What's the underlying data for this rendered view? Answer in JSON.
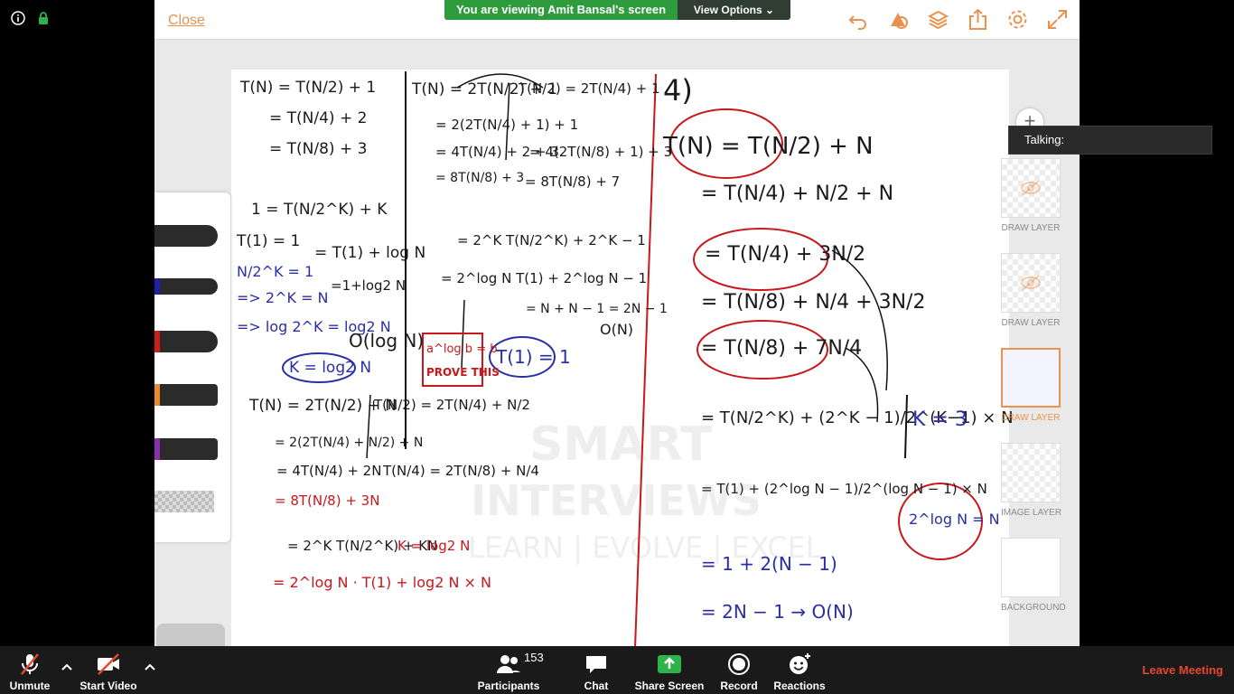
{
  "banner": {
    "message": "You are viewing Amit Bansal's screen",
    "view_options": "View Options"
  },
  "app": {
    "close_label": "Close",
    "tools": [
      "undo-icon",
      "shapes-icon",
      "layers-icon",
      "export-icon",
      "settings-icon",
      "fullscreen-icon"
    ],
    "layers": [
      {
        "label": "DRAW LAYER",
        "hidden": true
      },
      {
        "label": "DRAW LAYER",
        "hidden": true
      },
      {
        "label": "DRAW LAYER",
        "hidden": false,
        "active": true
      },
      {
        "label": "IMAGE LAYER",
        "hidden": false
      },
      {
        "label": "BACKGROUND",
        "hidden": false
      }
    ],
    "brush_colors": [
      "#2b2b2b",
      "#1f1fa8",
      "#d01c1c",
      "#e98a2b",
      "#8b2fb0"
    ]
  },
  "whiteboard": {
    "watermark": [
      "SMART",
      "INTERVIEWS",
      "LEARN | EVOLVE | EXCEL"
    ],
    "col1": {
      "l1": "T(N) = T(N/2) + 1",
      "l2": "= T(N/4) + 2",
      "l3": "= T(N/8) + 3",
      "l4": "1 = T(N/2^K) + K",
      "l5": "T(1) = 1",
      "l6": "= T(1) + log N",
      "l7": "N/2^K = 1",
      "l8": "=> 2^K = N",
      "l9": "=1+log2 N",
      "l10": "=> log 2^K = log2 N",
      "l11": "O(log N)",
      "l12": "K = log2 N"
    },
    "col2": {
      "l1": "T(N) = 2T(N/2) + 1",
      "l2": "T(N/2) = 2T(N/4) + 1",
      "l3": "= 2(2T(N/4) + 1) + 1",
      "l4": "= 4T(N/4) + 2 + 3",
      "l5": "= 4(2T(N/8) + 1) + 3",
      "l6": "= 8T(N/8) + 3",
      "l7": "= 8T(N/8) + 7",
      "l8": "= 2^K T(N/2^K) + 2^K − 1",
      "l9": "= 2^log N T(1) + 2^log N − 1",
      "l10": "= N + N − 1 = 2N − 1",
      "l11": "O(N)",
      "prove": [
        "a^log b = b",
        "PROVE THIS"
      ],
      "t1": "T(1) = 1"
    },
    "col3": {
      "l1": "T(N) = 2T(N/2) + N",
      "l2": "T(N/2) = 2T(N/4) + N/2",
      "l3": "= 2(2T(N/4) + N/2) + N",
      "l4": "= 4T(N/4) + 2N",
      "l5": "T(N/4) = 2T(N/8) + N/4",
      "l6": "= 8T(N/8) + 3N",
      "l7": "= 2^K T(N/2^K) + KN",
      "l8": "K = log2 N",
      "l9": "= 2^log N · T(1) + log2 N × N"
    },
    "col4": {
      "num": "4)",
      "l1": "T(N) = T(N/2) + N",
      "l2": "= T(N/4) + N/2 + N",
      "l3": "= T(N/4) + 3N/2",
      "l4": "= T(N/8) + N/4 + 3N/2",
      "l5": "= T(N/8) + 7N/4",
      "l6": "= T(N/2^K) + (2^K − 1)/2^(K−1) × N",
      "l7": "K = 3",
      "l8": "= T(1) + (2^log N − 1)/2^(log N − 1) × N",
      "l9": "2^log N = N",
      "l10": "= 1 + 2(N − 1)",
      "l11": "= 2N − 1 → O(N)"
    }
  },
  "talking": "Talking:",
  "toolbar": {
    "unmute": "Unmute",
    "start_video": "Start Video",
    "participants": "Participants",
    "participant_count": "153",
    "chat": "Chat",
    "share_screen": "Share Screen",
    "record": "Record",
    "reactions": "Reactions",
    "leave": "Leave Meeting"
  }
}
